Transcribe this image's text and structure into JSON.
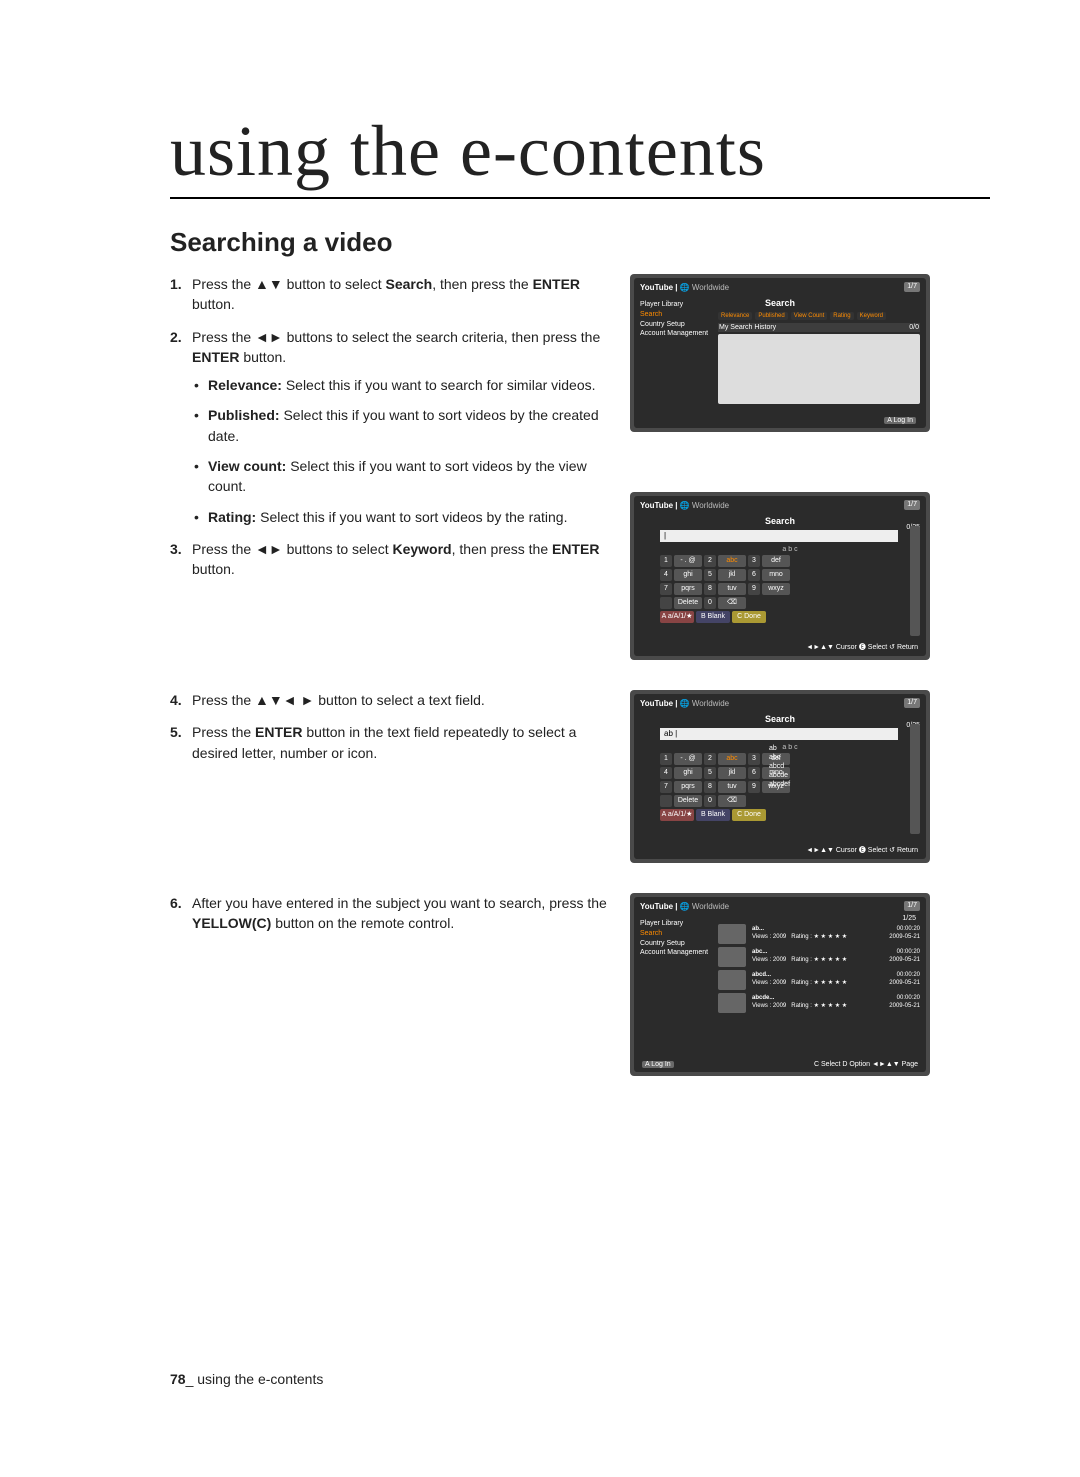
{
  "page": {
    "main_title": "using the e-contents",
    "subhead": "Searching a video",
    "footer_num": "78",
    "footer_sep": "_",
    "footer_text": "using the e-contents"
  },
  "steps": {
    "s1": {
      "num": "1.",
      "pre": "Press the ",
      "arrows": "▲▼",
      "mid": " button to select ",
      "kw": "Search",
      "post": ", then press the ",
      "btn": "ENTER",
      "end": " button."
    },
    "s2": {
      "num": "2.",
      "pre": "Press the ",
      "arrows": "◄►",
      "mid": " buttons to select the search criteria, then press the ",
      "btn": "ENTER",
      "end": " button."
    },
    "s3": {
      "num": "3.",
      "pre": "Press the ",
      "arrows": "◄►",
      "mid": " buttons to select ",
      "kw": "Keyword",
      "post": ", then press the ",
      "btn": "ENTER",
      "end": " button."
    },
    "s4": {
      "num": "4.",
      "pre": "Press the ",
      "arrows": "▲▼◄ ►",
      "end": " button to select a text field."
    },
    "s5": {
      "num": "5.",
      "pre": "Press the ",
      "btn": "ENTER",
      "end": " button in the text field repeatedly to select a desired letter, number or icon."
    },
    "s6": {
      "num": "6.",
      "pre": "After you have entered in the subject you want to search, press the ",
      "kw": "YELLOW(C)",
      "end": " button on the remote control."
    }
  },
  "bullets": {
    "b1": {
      "kw": "Relevance:",
      "txt": " Select this if you want to search for similar videos."
    },
    "b2": {
      "kw": "Published:",
      "txt": " Select this if you want to sort videos by the created date."
    },
    "b3": {
      "kw": "View count:",
      "txt": " Select this if you want to sort videos by the view count."
    },
    "b4": {
      "kw": "Rating:",
      "txt": " Select this if you want to sort videos by the rating."
    }
  },
  "shots": {
    "brand": "YouTube | ",
    "world": "🌐 Worldwide",
    "badge": "1/7",
    "title_search": "Search",
    "side": {
      "i1": "Player Library",
      "i2": "Search",
      "i3": "Country Setup",
      "i4": "Account Management"
    },
    "tabs": {
      "t1": "Relevance",
      "t2": "Published",
      "t3": "View Count",
      "t4": "Rating",
      "t5": "Keyword"
    },
    "hist_label": "My Search History",
    "hist_count": "0/0",
    "login": "A Log In",
    "kbd": {
      "scroll_top": "0/25",
      "hint": "a b c",
      "k1": "1",
      "k1t": "- . @",
      "k2": "2",
      "k2t": "abc",
      "k3": "3",
      "k3t": "def",
      "k4": "4",
      "k4t": "ghi",
      "k5": "5",
      "k5t": "jkl",
      "k6": "6",
      "k6t": "mno",
      "k7": "7",
      "k7t": "pqrs",
      "k8": "8",
      "k8t": "tuv",
      "k9": "9",
      "k9t": "wxyz",
      "k0": "0",
      "kdel": "Delete",
      "kbsp": "⌫",
      "kshift": "A a/A/1/★",
      "kblank": "B Blank",
      "kdone": "C Done",
      "input_value": "ab",
      "cursor_hint": "◄►▲▼ Cursor   🅔 Select   ↺ Return",
      "sugg": {
        "s1": "ab",
        "s2": "abc",
        "s3": "abcd",
        "s4": "abcde",
        "s5": "abcdef"
      }
    },
    "results": {
      "page": "1/25",
      "rows": [
        {
          "title": "ab...",
          "views": "Views : 2009",
          "rating": "Rating : ★ ★ ★ ★ ★",
          "dur": "00:00:20",
          "date": "2009-05-21"
        },
        {
          "title": "abc...",
          "views": "Views : 2009",
          "rating": "Rating : ★ ★ ★ ★ ★",
          "dur": "00:00:20",
          "date": "2009-05-21"
        },
        {
          "title": "abcd...",
          "views": "Views : 2009",
          "rating": "Rating : ★ ★ ★ ★ ★",
          "dur": "00:00:20",
          "date": "2009-05-21"
        },
        {
          "title": "abcde...",
          "views": "Views : 2009",
          "rating": "Rating : ★ ★ ★ ★ ★",
          "dur": "00:00:20",
          "date": "2009-05-21"
        }
      ],
      "footer": "C Select   D Option   ◄►▲▼ Page"
    }
  }
}
